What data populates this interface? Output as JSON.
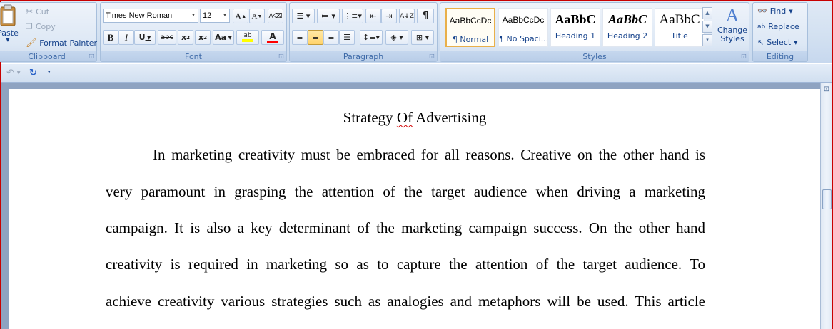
{
  "clipboard": {
    "label": "Clipboard",
    "paste": "Paste",
    "cut": "Cut",
    "copy": "Copy",
    "format_painter": "Format Painter"
  },
  "font": {
    "label": "Font",
    "font_name": "Times New Roman",
    "font_size": "12",
    "grow": "A",
    "shrink": "A",
    "bold": "B",
    "italic": "I",
    "underline": "U",
    "strikethrough": "abc",
    "subscript": "x",
    "superscript": "x",
    "change_case": "Aa",
    "highlight": "ab",
    "font_color": "A"
  },
  "paragraph": {
    "label": "Paragraph",
    "pilcrow": "¶"
  },
  "styles": {
    "label": "Styles",
    "items": [
      {
        "sample": "AaBbCcDc",
        "name": "¶ Normal"
      },
      {
        "sample": "AaBbCcDc",
        "name": "¶ No Spaci..."
      },
      {
        "sample": "AaBbC",
        "name": "Heading 1"
      },
      {
        "sample": "AaBbC",
        "name": "Heading 2"
      },
      {
        "sample": "AaBbC",
        "name": "Title"
      }
    ],
    "change_styles": "Change Styles"
  },
  "editing": {
    "label": "Editing",
    "find": "Find",
    "replace": "Replace",
    "select": "Select"
  },
  "document": {
    "title_word1": "Strategy",
    "title_word2": "Of",
    "title_word3": "Advertising",
    "lines": [
      "In marketing creativity must be embraced for all reasons. Creative on the other hand is",
      "very paramount in grasping the attention of the target audience when driving a marketing",
      "campaign. It is also a key determinant of the marketing campaign success. On the other hand",
      "creativity is required in marketing so as to capture the attention of the target audience. To",
      "achieve creativity various strategies such as analogies and metaphors will be used. This article"
    ]
  },
  "colors": {
    "highlight": "#ffff00",
    "font_color": "#ff0000",
    "selected_style_border": "#e9b04a",
    "spell_squiggle": "#d00000"
  }
}
